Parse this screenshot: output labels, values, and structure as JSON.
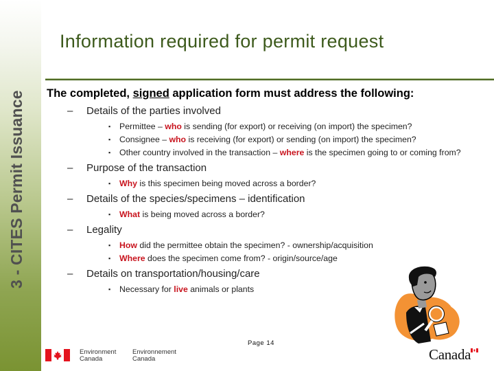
{
  "sidebar": {
    "title": "3 - CITES Permit Issuance"
  },
  "header": {
    "title": "Information required for permit request"
  },
  "colors": {
    "title_green": "#3d5a1c",
    "rule_green": "#4e6a25",
    "highlight_red": "#c8141e",
    "sidebar_green_dark": "#7a9332"
  },
  "content": {
    "intro": {
      "before": "The completed, ",
      "underlined": "signed",
      "after": " application form must address the following:"
    },
    "sections": [
      {
        "heading": "Details of the parties involved",
        "items": [
          {
            "pre": "Permittee – ",
            "hl": "who",
            "post": " is sending (for export) or receiving (on import) the specimen?"
          },
          {
            "pre": "Consignee – ",
            "hl": "who",
            "post": " is receiving (for export) or sending (on import) the specimen?"
          },
          {
            "pre": "Other country involved in the transaction – ",
            "hl": "where",
            "post": " is the specimen going to or coming from?"
          }
        ]
      },
      {
        "heading": "Purpose of the transaction",
        "items": [
          {
            "pre": "",
            "hl": "Why",
            "post": " is this specimen being moved across a border?"
          }
        ]
      },
      {
        "heading": "Details of the species/specimens – identification",
        "items": [
          {
            "pre": "",
            "hl": "What",
            "post": " is being moved across a border?"
          }
        ]
      },
      {
        "heading": "Legality",
        "items": [
          {
            "pre": "",
            "hl": "How",
            "post": " did the permittee obtain the specimen? - ownership/acquisition"
          },
          {
            "pre": "",
            "hl": "Where",
            "post": " does the specimen come from?  - origin/source/age"
          }
        ]
      },
      {
        "heading": "Details on transportation/housing/care",
        "items": [
          {
            "pre": "Necessary for ",
            "hl": "live",
            "post": " animals or plants"
          }
        ]
      }
    ],
    "dash_glyph": "–",
    "bullet_glyph": "▪"
  },
  "illustration": {
    "icon": "inspector-with-magnifying-glass-icon"
  },
  "footer": {
    "page_label": "Page 14",
    "dept_en_line1": "Environment",
    "dept_en_line2": "Canada",
    "dept_fr_line1": "Environnement",
    "dept_fr_line2": "Canada",
    "wordmark": "Canada"
  }
}
